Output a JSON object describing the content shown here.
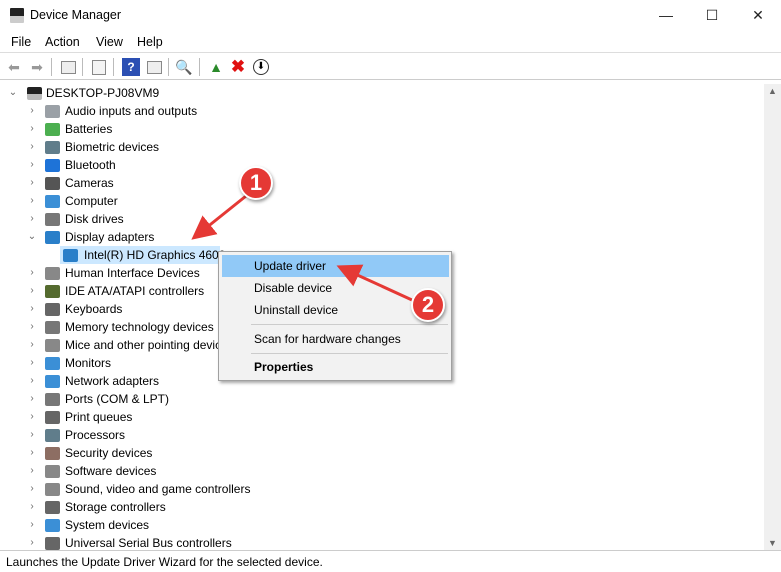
{
  "window": {
    "title": "Device Manager",
    "controls": [
      "minimize",
      "maximize",
      "close"
    ]
  },
  "menubar": [
    "File",
    "Action",
    "View",
    "Help"
  ],
  "toolbar": [
    "back-icon",
    "forward-icon",
    "show-hide-console-tree-icon",
    "properties-icon",
    "help-icon",
    "run-icon",
    "scan-hardware-icon",
    "update-driver-icon",
    "uninstall-icon",
    "disable-icon"
  ],
  "tree": {
    "root": "DESKTOP-PJ08VM9",
    "items": [
      {
        "label": "Audio inputs and outputs",
        "color": "#9aa0a6"
      },
      {
        "label": "Batteries",
        "color": "#4caf50"
      },
      {
        "label": "Biometric devices",
        "color": "#607d8b"
      },
      {
        "label": "Bluetooth",
        "color": "#1e73d8"
      },
      {
        "label": "Cameras",
        "color": "#555555"
      },
      {
        "label": "Computer",
        "color": "#3b8fd6"
      },
      {
        "label": "Disk drives",
        "color": "#777777"
      },
      {
        "label": "Display adapters",
        "color": "#2a7fc9",
        "expanded": true,
        "children": [
          "Intel(R) HD Graphics 4600"
        ]
      },
      {
        "label": "Human Interface Devices",
        "color": "#888888"
      },
      {
        "label": "IDE ATA/ATAPI controllers",
        "color": "#556b2f"
      },
      {
        "label": "Keyboards",
        "color": "#666666"
      },
      {
        "label": "Memory technology devices",
        "color": "#777777"
      },
      {
        "label": "Mice and other pointing devices",
        "color": "#888888"
      },
      {
        "label": "Monitors",
        "color": "#3b8fd6"
      },
      {
        "label": "Network adapters",
        "color": "#3b8fd6"
      },
      {
        "label": "Ports (COM & LPT)",
        "color": "#777777"
      },
      {
        "label": "Print queues",
        "color": "#666666"
      },
      {
        "label": "Processors",
        "color": "#607d8b"
      },
      {
        "label": "Security devices",
        "color": "#8d6e63"
      },
      {
        "label": "Software devices",
        "color": "#888888"
      },
      {
        "label": "Sound, video and game controllers",
        "color": "#888888"
      },
      {
        "label": "Storage controllers",
        "color": "#666666"
      },
      {
        "label": "System devices",
        "color": "#3b8fd6"
      },
      {
        "label": "Universal Serial Bus controllers",
        "color": "#666666"
      }
    ]
  },
  "context_menu": {
    "items": [
      "Update driver",
      "Disable device",
      "Uninstall device",
      "Scan for hardware changes",
      "Properties"
    ],
    "highlighted": "Update driver"
  },
  "annotations": {
    "step1": "1",
    "step2": "2",
    "color": "#e53935"
  },
  "status": "Launches the Update Driver Wizard for the selected device."
}
